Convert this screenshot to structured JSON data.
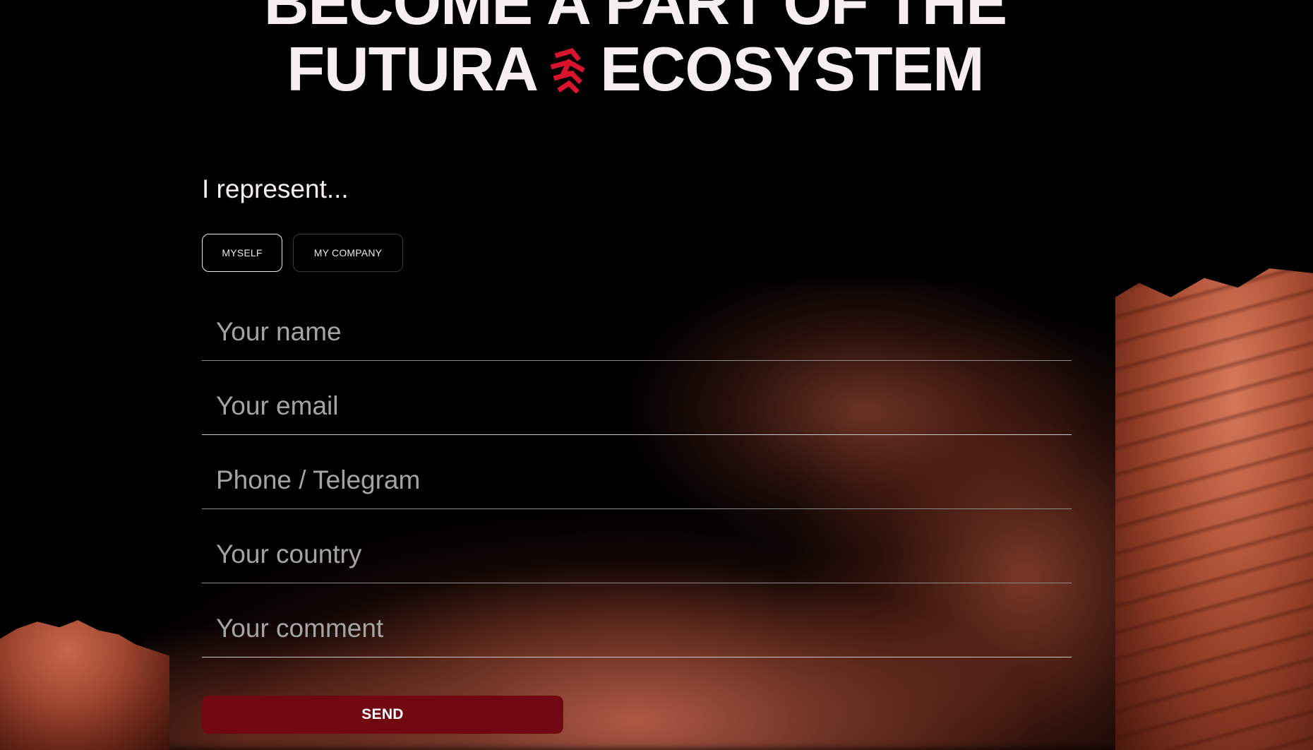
{
  "headline": {
    "line1": "BECOME A PART OF THE",
    "line2_part1": "FUTURA",
    "line2_part2": "ECOSYSTEM",
    "logo_icon": "futura-logo-icon",
    "logo_color": "#d8132d"
  },
  "form": {
    "represent_label": "I represent...",
    "toggle": {
      "options": [
        "MYSELF",
        "MY COMPANY"
      ],
      "selected": "MYSELF"
    },
    "fields": {
      "name": {
        "value": "",
        "placeholder": "Your name"
      },
      "email": {
        "value": "",
        "placeholder": "Your email"
      },
      "phone": {
        "value": "",
        "placeholder": "Phone / Telegram"
      },
      "country": {
        "value": "",
        "placeholder": "Your country"
      },
      "comment": {
        "value": "",
        "placeholder": "Your comment"
      }
    },
    "send_label": "SEND",
    "send_color": "#700711"
  }
}
